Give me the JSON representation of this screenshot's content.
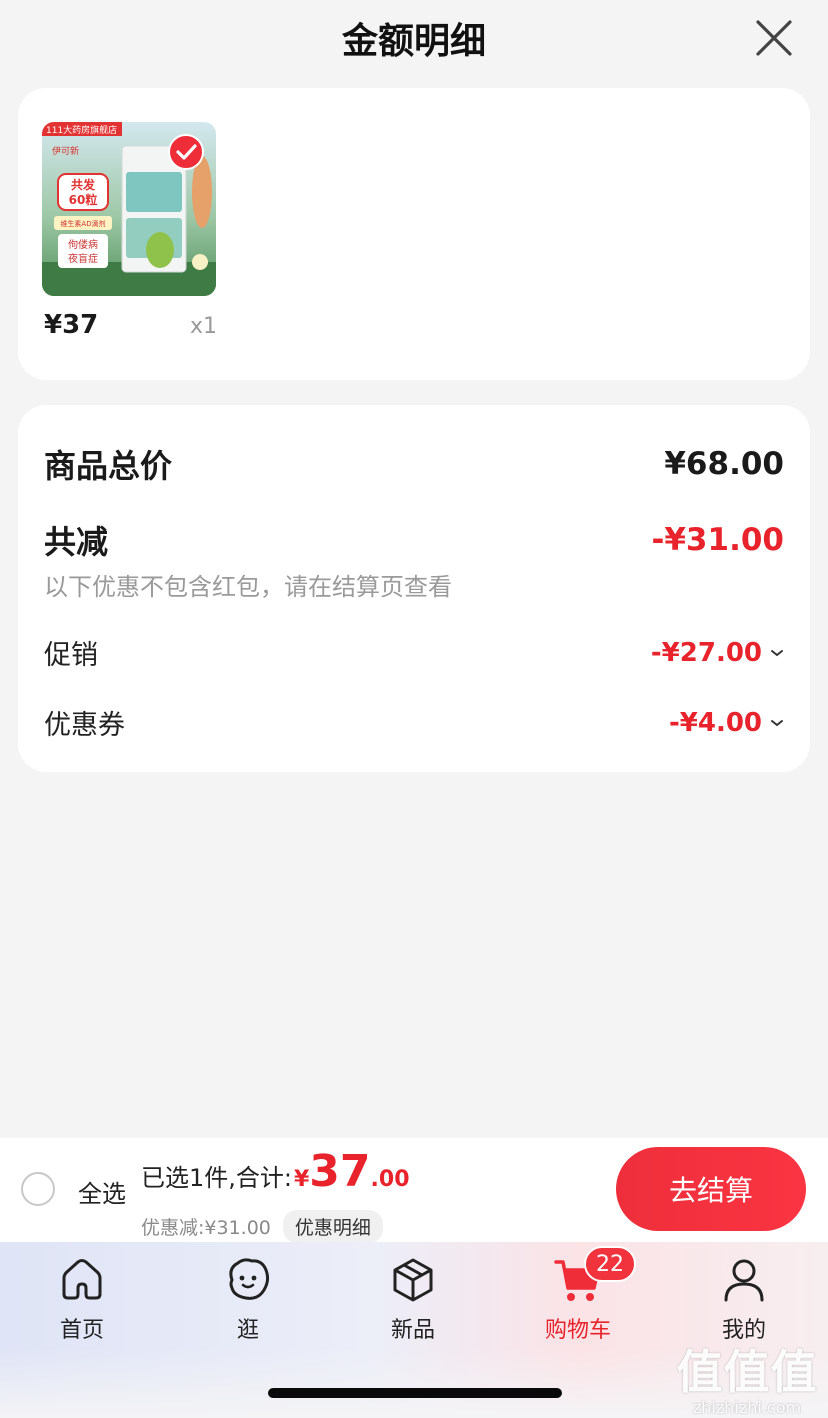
{
  "header": {
    "title": "金额明细"
  },
  "product": {
    "store_banner": "111大药房旗舰店",
    "brand_tag": "伊可新",
    "promo_box": "共发\n60粒",
    "promo_box_line1": "共发",
    "promo_box_line2": "60粒",
    "sub_tag": "维生素AD滴剂",
    "side_tag_line1": "佝偻病",
    "side_tag_line2": "夜盲症",
    "price": "¥37",
    "quantity": "x1",
    "selected": true
  },
  "summary": {
    "total_label": "商品总价",
    "total_value": "¥68.00",
    "reduce_label": "共减",
    "reduce_value": "-¥31.00",
    "hint": "以下优惠不包含红包，请在结算页查看",
    "promo_label": "促销",
    "promo_value": "-¥27.00",
    "coupon_label": "优惠券",
    "coupon_value": "-¥4.00"
  },
  "checkout": {
    "select_all_label": "全选",
    "summary_text": "已选1件,合计:",
    "total_currency": "¥",
    "total_integer": "37",
    "total_decimal": ".00",
    "discount_text": "优惠减:¥31.00",
    "detail_chip": "优惠明细",
    "button_label": "去结算"
  },
  "tabs": [
    {
      "label": "首页",
      "icon": "home-icon"
    },
    {
      "label": "逛",
      "icon": "browse-face-icon"
    },
    {
      "label": "新品",
      "icon": "box-icon"
    },
    {
      "label": "购物车",
      "icon": "cart-icon",
      "badge": "22",
      "active": true
    },
    {
      "label": "我的",
      "icon": "profile-icon"
    }
  ],
  "watermark": {
    "text": "值值值",
    "domain": "zhizhizhi.com"
  },
  "colors": {
    "accent": "#e8232b",
    "button": "#f12e3c"
  }
}
